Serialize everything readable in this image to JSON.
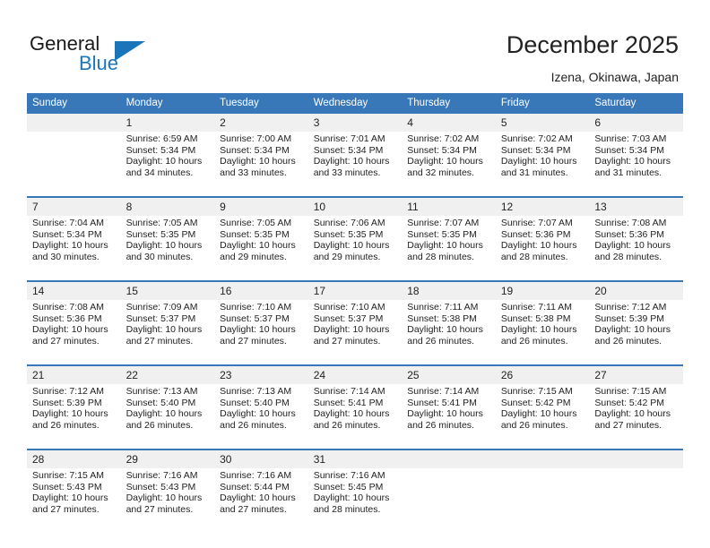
{
  "brand": {
    "name_part1": "General",
    "name_part2": "Blue",
    "accent_color": "#1b75bb"
  },
  "header": {
    "title": "December 2025",
    "subtitle": "Izena, Okinawa, Japan"
  },
  "calendar": {
    "header_color": "#3878b8",
    "weekday_headers": [
      "Sunday",
      "Monday",
      "Tuesday",
      "Wednesday",
      "Thursday",
      "Friday",
      "Saturday"
    ],
    "weeks": [
      [
        {
          "day": "",
          "lines": []
        },
        {
          "day": "1",
          "lines": [
            "Sunrise: 6:59 AM",
            "Sunset: 5:34 PM",
            "Daylight: 10 hours",
            "and 34 minutes."
          ]
        },
        {
          "day": "2",
          "lines": [
            "Sunrise: 7:00 AM",
            "Sunset: 5:34 PM",
            "Daylight: 10 hours",
            "and 33 minutes."
          ]
        },
        {
          "day": "3",
          "lines": [
            "Sunrise: 7:01 AM",
            "Sunset: 5:34 PM",
            "Daylight: 10 hours",
            "and 33 minutes."
          ]
        },
        {
          "day": "4",
          "lines": [
            "Sunrise: 7:02 AM",
            "Sunset: 5:34 PM",
            "Daylight: 10 hours",
            "and 32 minutes."
          ]
        },
        {
          "day": "5",
          "lines": [
            "Sunrise: 7:02 AM",
            "Sunset: 5:34 PM",
            "Daylight: 10 hours",
            "and 31 minutes."
          ]
        },
        {
          "day": "6",
          "lines": [
            "Sunrise: 7:03 AM",
            "Sunset: 5:34 PM",
            "Daylight: 10 hours",
            "and 31 minutes."
          ]
        }
      ],
      [
        {
          "day": "7",
          "lines": [
            "Sunrise: 7:04 AM",
            "Sunset: 5:34 PM",
            "Daylight: 10 hours",
            "and 30 minutes."
          ]
        },
        {
          "day": "8",
          "lines": [
            "Sunrise: 7:05 AM",
            "Sunset: 5:35 PM",
            "Daylight: 10 hours",
            "and 30 minutes."
          ]
        },
        {
          "day": "9",
          "lines": [
            "Sunrise: 7:05 AM",
            "Sunset: 5:35 PM",
            "Daylight: 10 hours",
            "and 29 minutes."
          ]
        },
        {
          "day": "10",
          "lines": [
            "Sunrise: 7:06 AM",
            "Sunset: 5:35 PM",
            "Daylight: 10 hours",
            "and 29 minutes."
          ]
        },
        {
          "day": "11",
          "lines": [
            "Sunrise: 7:07 AM",
            "Sunset: 5:35 PM",
            "Daylight: 10 hours",
            "and 28 minutes."
          ]
        },
        {
          "day": "12",
          "lines": [
            "Sunrise: 7:07 AM",
            "Sunset: 5:36 PM",
            "Daylight: 10 hours",
            "and 28 minutes."
          ]
        },
        {
          "day": "13",
          "lines": [
            "Sunrise: 7:08 AM",
            "Sunset: 5:36 PM",
            "Daylight: 10 hours",
            "and 28 minutes."
          ]
        }
      ],
      [
        {
          "day": "14",
          "lines": [
            "Sunrise: 7:08 AM",
            "Sunset: 5:36 PM",
            "Daylight: 10 hours",
            "and 27 minutes."
          ]
        },
        {
          "day": "15",
          "lines": [
            "Sunrise: 7:09 AM",
            "Sunset: 5:37 PM",
            "Daylight: 10 hours",
            "and 27 minutes."
          ]
        },
        {
          "day": "16",
          "lines": [
            "Sunrise: 7:10 AM",
            "Sunset: 5:37 PM",
            "Daylight: 10 hours",
            "and 27 minutes."
          ]
        },
        {
          "day": "17",
          "lines": [
            "Sunrise: 7:10 AM",
            "Sunset: 5:37 PM",
            "Daylight: 10 hours",
            "and 27 minutes."
          ]
        },
        {
          "day": "18",
          "lines": [
            "Sunrise: 7:11 AM",
            "Sunset: 5:38 PM",
            "Daylight: 10 hours",
            "and 26 minutes."
          ]
        },
        {
          "day": "19",
          "lines": [
            "Sunrise: 7:11 AM",
            "Sunset: 5:38 PM",
            "Daylight: 10 hours",
            "and 26 minutes."
          ]
        },
        {
          "day": "20",
          "lines": [
            "Sunrise: 7:12 AM",
            "Sunset: 5:39 PM",
            "Daylight: 10 hours",
            "and 26 minutes."
          ]
        }
      ],
      [
        {
          "day": "21",
          "lines": [
            "Sunrise: 7:12 AM",
            "Sunset: 5:39 PM",
            "Daylight: 10 hours",
            "and 26 minutes."
          ]
        },
        {
          "day": "22",
          "lines": [
            "Sunrise: 7:13 AM",
            "Sunset: 5:40 PM",
            "Daylight: 10 hours",
            "and 26 minutes."
          ]
        },
        {
          "day": "23",
          "lines": [
            "Sunrise: 7:13 AM",
            "Sunset: 5:40 PM",
            "Daylight: 10 hours",
            "and 26 minutes."
          ]
        },
        {
          "day": "24",
          "lines": [
            "Sunrise: 7:14 AM",
            "Sunset: 5:41 PM",
            "Daylight: 10 hours",
            "and 26 minutes."
          ]
        },
        {
          "day": "25",
          "lines": [
            "Sunrise: 7:14 AM",
            "Sunset: 5:41 PM",
            "Daylight: 10 hours",
            "and 26 minutes."
          ]
        },
        {
          "day": "26",
          "lines": [
            "Sunrise: 7:15 AM",
            "Sunset: 5:42 PM",
            "Daylight: 10 hours",
            "and 26 minutes."
          ]
        },
        {
          "day": "27",
          "lines": [
            "Sunrise: 7:15 AM",
            "Sunset: 5:42 PM",
            "Daylight: 10 hours",
            "and 27 minutes."
          ]
        }
      ],
      [
        {
          "day": "28",
          "lines": [
            "Sunrise: 7:15 AM",
            "Sunset: 5:43 PM",
            "Daylight: 10 hours",
            "and 27 minutes."
          ]
        },
        {
          "day": "29",
          "lines": [
            "Sunrise: 7:16 AM",
            "Sunset: 5:43 PM",
            "Daylight: 10 hours",
            "and 27 minutes."
          ]
        },
        {
          "day": "30",
          "lines": [
            "Sunrise: 7:16 AM",
            "Sunset: 5:44 PM",
            "Daylight: 10 hours",
            "and 27 minutes."
          ]
        },
        {
          "day": "31",
          "lines": [
            "Sunrise: 7:16 AM",
            "Sunset: 5:45 PM",
            "Daylight: 10 hours",
            "and 28 minutes."
          ]
        },
        {
          "day": "",
          "lines": []
        },
        {
          "day": "",
          "lines": []
        },
        {
          "day": "",
          "lines": []
        }
      ]
    ]
  }
}
